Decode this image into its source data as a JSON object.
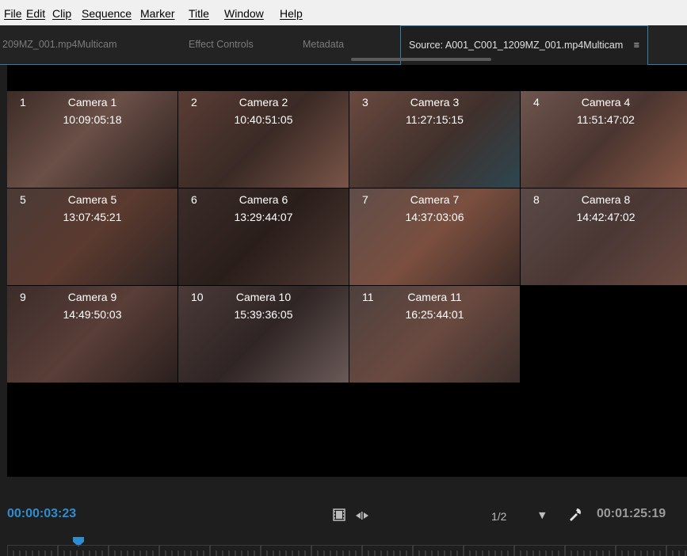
{
  "menu": [
    "File",
    "Edit",
    "Clip",
    "Sequence",
    "Marker",
    "Title",
    "Window",
    "Help"
  ],
  "tabs": {
    "partial": "209MZ_001.mp4Multicam",
    "effect_controls": "Effect Controls",
    "metadata": "Metadata",
    "source": "Source: A001_C001_1209MZ_001.mp4Multicam",
    "menu_glyph": "≡"
  },
  "cameras": [
    {
      "num": "1",
      "name": "Camera 1",
      "tc": "10:09:05:18"
    },
    {
      "num": "2",
      "name": "Camera 2",
      "tc": "10:40:51:05"
    },
    {
      "num": "3",
      "name": "Camera 3",
      "tc": "11:27:15:15"
    },
    {
      "num": "4",
      "name": "Camera 4",
      "tc": "11:51:47:02"
    },
    {
      "num": "5",
      "name": "Camera 5",
      "tc": "13:07:45:21"
    },
    {
      "num": "6",
      "name": "Camera 6",
      "tc": "13:29:44:07"
    },
    {
      "num": "7",
      "name": "Camera 7",
      "tc": "14:37:03:06"
    },
    {
      "num": "8",
      "name": "Camera 8",
      "tc": "14:42:47:02"
    },
    {
      "num": "9",
      "name": "Camera 9",
      "tc": "14:49:50:03"
    },
    {
      "num": "10",
      "name": "Camera 10",
      "tc": "15:39:36:05"
    },
    {
      "num": "11",
      "name": "Camera 11",
      "tc": "16:25:44:01"
    }
  ],
  "selected_camera": 8,
  "controls": {
    "current_timecode": "00:00:03:23",
    "duration_timecode": "00:01:25:19",
    "resolution": "1/2",
    "icons": [
      "film-icon",
      "trim-icon",
      "chevron-down-icon",
      "wrench-icon",
      "playhead-icon"
    ]
  },
  "colors": {
    "accent_blue": "#2f8ccf",
    "selection_yellow": "#ffff00",
    "tab_border": "#2d7fa3"
  }
}
